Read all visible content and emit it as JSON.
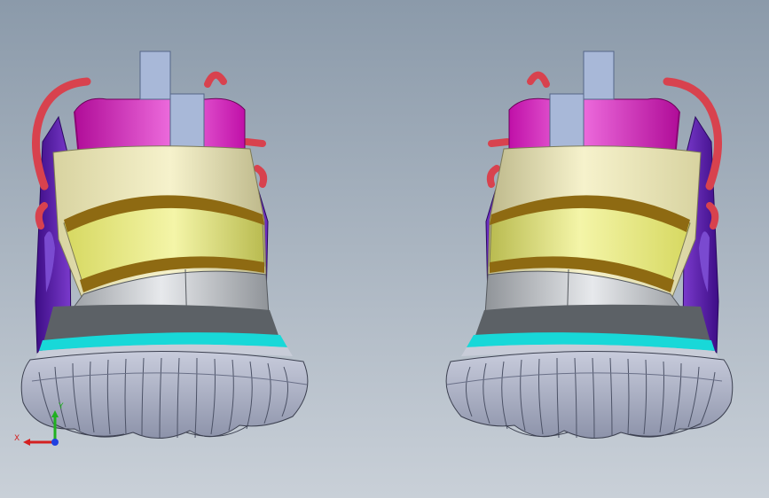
{
  "viewport": {
    "background_top": "#8b9aaa",
    "background_bottom": "#c9d0d8"
  },
  "colors": {
    "collar": "#d414b4",
    "collar_light": "#f06ae0",
    "lace": "#d8424e",
    "tab": "#a8b8d8",
    "cream": "#ece7b4",
    "yellow_band": "#e3e676",
    "brown_stripe": "#8e6a12",
    "purple": "#5a18a8",
    "heel_gray": "#c0c4c8",
    "dark_band": "#5c6166",
    "cyan": "#18d8d8",
    "sole": "#a2a8bd",
    "sole_dark": "#5d6275"
  },
  "triad": {
    "x_label": "X",
    "y_label": "Y",
    "x_color": "#d42020",
    "y_color": "#20b020",
    "z_color": "#2040e0"
  },
  "icons": [
    "coordinate-triad-icon"
  ]
}
